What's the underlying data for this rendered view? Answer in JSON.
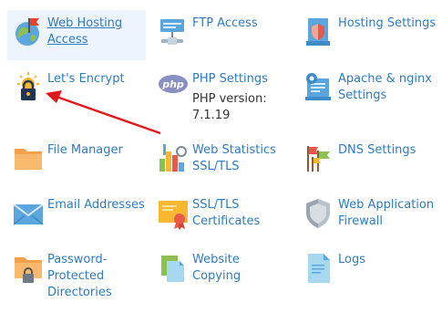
{
  "tiles": {
    "web_hosting_access": {
      "label1": "Web Hosting",
      "label2": "Access"
    },
    "ftp_access": {
      "label1": "FTP Access"
    },
    "hosting_settings": {
      "label1": "Hosting Settings"
    },
    "lets_encrypt": {
      "label1": "Let's Encrypt"
    },
    "php_settings": {
      "label1": "PHP Settings",
      "sub1": "PHP version:",
      "sub2": "7.1.19"
    },
    "apache_nginx": {
      "label1": "Apache & nginx",
      "label2": "Settings"
    },
    "file_manager": {
      "label1": "File Manager"
    },
    "web_statistics": {
      "label1": "Web Statistics",
      "label2": "SSL/TLS"
    },
    "dns_settings": {
      "label1": "DNS Settings"
    },
    "email_addresses": {
      "label1": "Email Addresses"
    },
    "ssl_tls_certificates": {
      "label1": "SSL/TLS",
      "label2": "Certificates"
    },
    "web_application_firewall": {
      "label1": "Web Application",
      "label2": "Firewall"
    },
    "password_protected_directories": {
      "label1": "Password-",
      "label2": "Protected",
      "label3": "Directories"
    },
    "website_copying": {
      "label1": "Website",
      "label2": "Copying"
    },
    "logs": {
      "label1": "Logs"
    }
  },
  "colors": {
    "link": "#2f7bbf",
    "selection_bg": "#eef4fb",
    "annotation_arrow": "#e0191d"
  }
}
